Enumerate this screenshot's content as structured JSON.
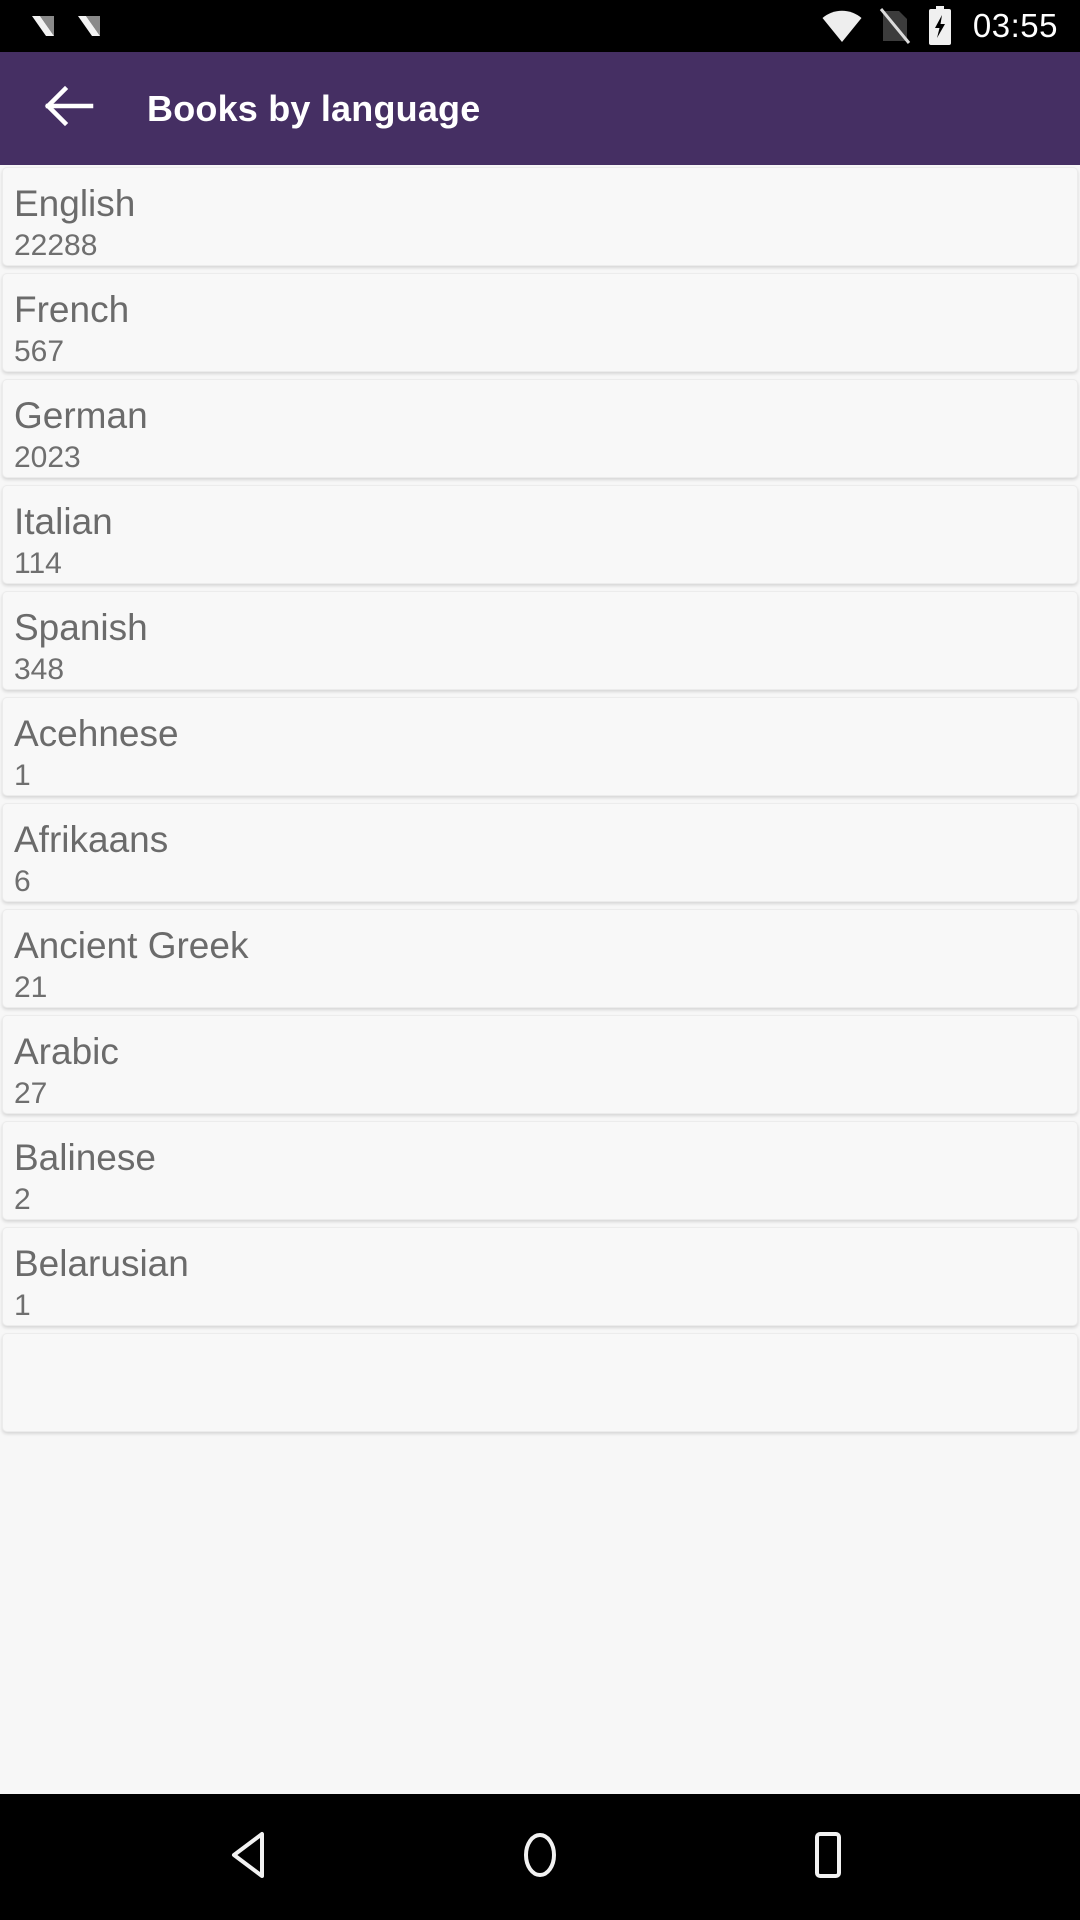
{
  "status_bar": {
    "notification_icons": [
      "nougat-n-icon",
      "nougat-n-icon"
    ],
    "wifi_icon": "wifi-icon",
    "sim_icon": "no-sim-icon",
    "battery_icon": "battery-charging-icon",
    "clock": "03:55",
    "background_color": "#000000",
    "foreground_color": "#ffffff"
  },
  "app_bar": {
    "back_icon": "back-arrow-icon",
    "title": "Books by language",
    "background_color": "#452f63",
    "title_color": "#ffffff"
  },
  "list": {
    "card_background_color": "#f8f8f8",
    "name_color": "#6b6b6b",
    "count_color": "#6f6f6f",
    "items": [
      {
        "language": "English",
        "count": "22288"
      },
      {
        "language": "French",
        "count": "567"
      },
      {
        "language": "German",
        "count": "2023"
      },
      {
        "language": "Italian",
        "count": "114"
      },
      {
        "language": "Spanish",
        "count": "348"
      },
      {
        "language": "Acehnese",
        "count": "1"
      },
      {
        "language": "Afrikaans",
        "count": "6"
      },
      {
        "language": "Ancient Greek",
        "count": "21"
      },
      {
        "language": "Arabic",
        "count": "27"
      },
      {
        "language": "Balinese",
        "count": "2"
      },
      {
        "language": "Belarusian",
        "count": "1"
      },
      {
        "language": "",
        "count": ""
      }
    ]
  },
  "nav_bar": {
    "back_icon": "nav-back-triangle-icon",
    "home_icon": "nav-home-circle-icon",
    "recents_icon": "nav-recents-square-icon",
    "background_color": "#000000"
  }
}
